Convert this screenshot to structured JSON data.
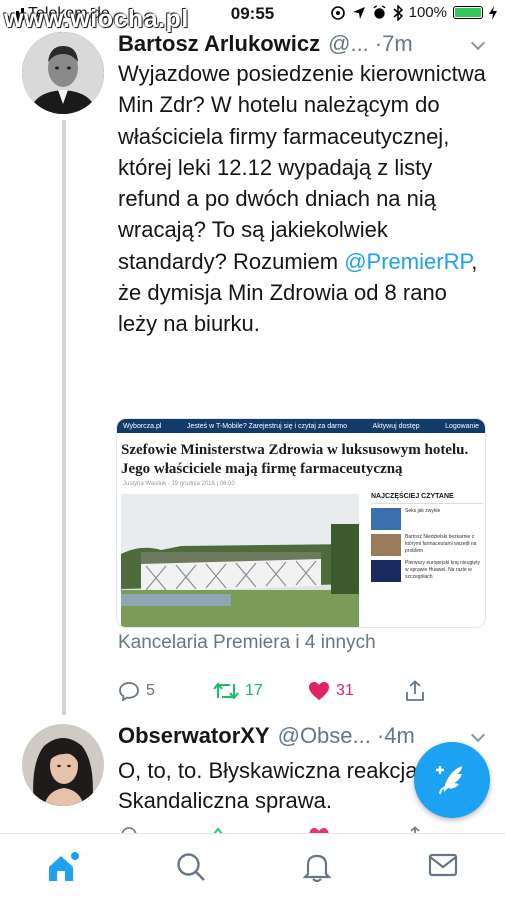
{
  "status_bar": {
    "carrier": "Telekom.de",
    "time": "09:55",
    "battery": "100%",
    "battery_level": 1.0
  },
  "watermark": "www.wiocha.pl",
  "tweet1": {
    "name": "Bartosz Arlukowicz",
    "handle": "@...",
    "dot": "·",
    "time": "7m",
    "text_before": "Wyjazdowe posiedzenie kierownictwa Min Zdr? W hotelu należącym do właściciela firmy farmaceutycznej, której leki 12.12 wypadają z listy refund a po dwóch dniach na nią wracają? To są jakiekolwiek standardy? Rozumiem ",
    "mention": "@PremierRP",
    "text_after": ", że dymisja Min Zdrowia od 8 rano leży na biurku.",
    "card": {
      "site": "Wyborcza.pl",
      "promo": "Jesteś w T-Mobile? Zarejestruj się i czytaj za darmo",
      "subscribe": "Aktywuj dostęp",
      "login": "Logowanie",
      "headline": "Szefowie Ministerstwa Zdrowia w luksusowym hotelu. Jego właściciele mają firmę farmaceutyczną",
      "byline": "Justyna Wasiluk · 19 grudnia 2018 | 06:00",
      "sidebar_title": "NAJCZĘŚCIEJ CZYTANE",
      "sidebar_items": [
        "Seks jak zwykle",
        "Bartosz Niedzielski bezkarnie z którymi farmaceutami wszedł na problem",
        "Pierwszy europejski kraj nieugięty w sprawie Huawei. Na razie w szczegółach"
      ]
    },
    "retweeters": "Kancelaria Premiera i 4 innych",
    "actions": {
      "replies": "5",
      "retweets": "17",
      "likes": "31"
    }
  },
  "tweet2": {
    "name": "ObserwatorXY",
    "handle": "@Obse...",
    "dot": "·",
    "time": "4m",
    "text": "O, to, to. Błyskawiczna reakcja. Skandaliczna sprawa."
  },
  "colors": {
    "accent": "#1da1f2",
    "retweet": "#17bf63",
    "like": "#e0245e",
    "muted": "#657786"
  },
  "icons": {
    "reply": "reply-icon",
    "retweet": "retweet-icon",
    "like": "heart-icon",
    "share": "share-icon",
    "compose": "compose-tweet-icon",
    "home": "home-icon",
    "search": "search-icon",
    "notifications": "bell-icon",
    "messages": "mail-icon"
  }
}
